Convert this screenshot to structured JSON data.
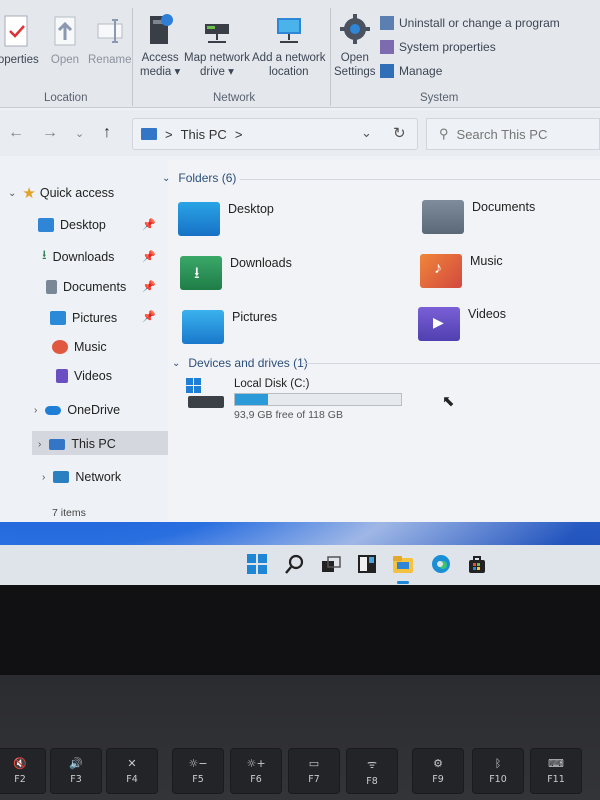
{
  "ribbon": {
    "location_buttons": [
      {
        "label": "roperties",
        "dim": false
      },
      {
        "label": "Open",
        "dim": true
      },
      {
        "label": "Rename",
        "dim": true
      }
    ],
    "network_buttons": [
      {
        "line1": "Access",
        "line2": "media ▾"
      },
      {
        "line1": "Map network",
        "line2": "drive ▾"
      },
      {
        "line1": "Add a network",
        "line2": "location"
      }
    ],
    "system_open_settings": {
      "line1": "Open",
      "line2": "Settings"
    },
    "system_items": [
      "Uninstall or change a program",
      "System properties",
      "Manage"
    ],
    "groups": [
      "Location",
      "Network",
      "System"
    ]
  },
  "address": {
    "path": "This PC",
    "separator": ">",
    "search_placeholder": "Search This PC"
  },
  "nav": {
    "quick_access": "Quick access",
    "quick_items": [
      "Desktop",
      "Downloads",
      "Documents",
      "Pictures",
      "Music",
      "Videos"
    ],
    "onedrive": "OneDrive",
    "this_pc": "This PC",
    "network": "Network",
    "status": "7 items"
  },
  "content": {
    "folders_header": "Folders (6)",
    "folders": [
      "Desktop",
      "Documents",
      "Downloads",
      "Music",
      "Pictures",
      "Videos"
    ],
    "devices_header": "Devices and drives (1)",
    "drive": {
      "name": "Local Disk (C:)",
      "free": "93,9 GB free of 118 GB",
      "used_fraction": 0.2
    }
  },
  "keys": [
    {
      "icon": "🔇",
      "label": "F2"
    },
    {
      "icon": "🔊",
      "label": "F3"
    },
    {
      "icon": "✕",
      "label": "F4"
    },
    {
      "icon": "☼−",
      "label": "F5"
    },
    {
      "icon": "☼+",
      "label": "F6"
    },
    {
      "icon": "▭",
      "label": "F7"
    },
    {
      "icon": "ᯤ",
      "label": "F8"
    },
    {
      "icon": "⚙",
      "label": "F9"
    },
    {
      "icon": "ᛒ",
      "label": "F10"
    },
    {
      "icon": "⌨",
      "label": "F11"
    }
  ],
  "colors": {
    "accent": "#2a9ad8",
    "folder_blue": "#1f7fd6"
  }
}
